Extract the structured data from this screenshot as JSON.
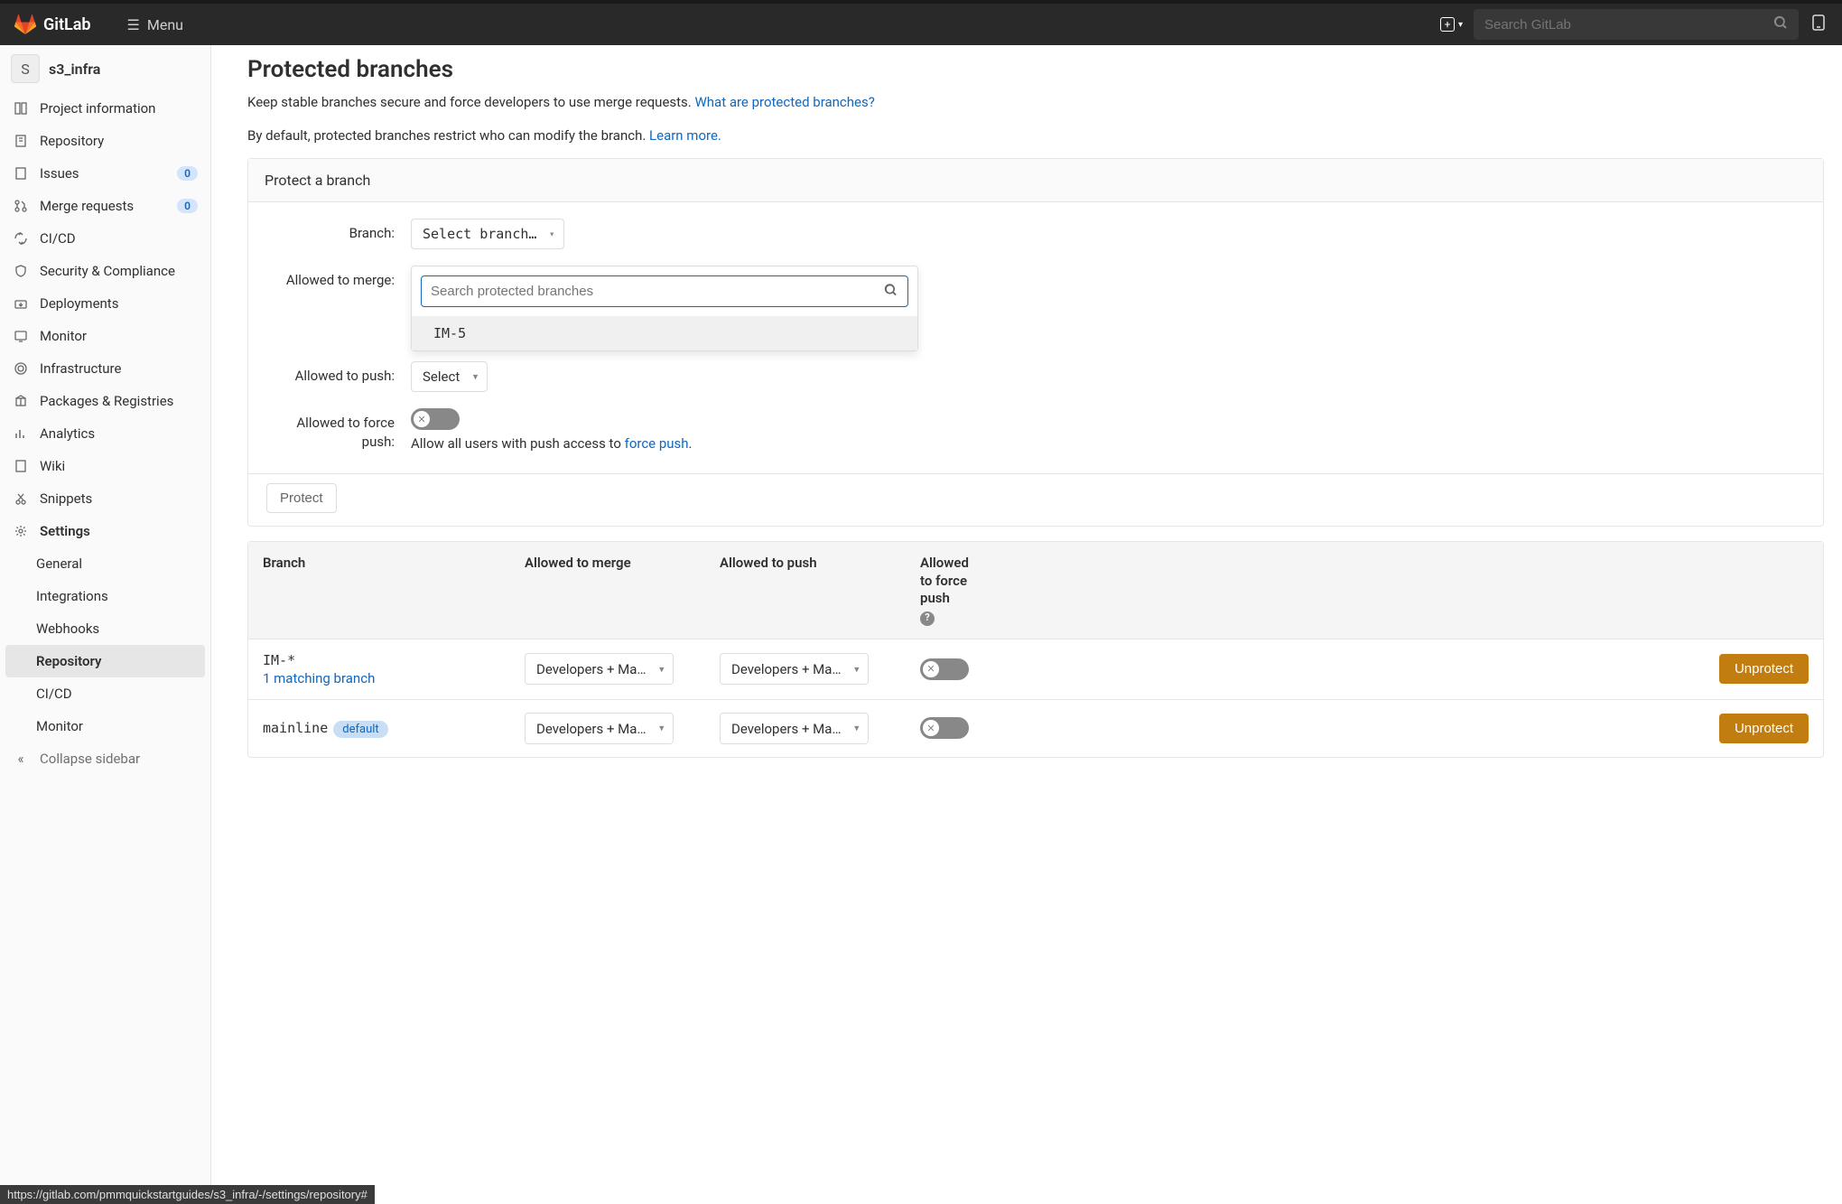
{
  "header": {
    "brand": "GitLab",
    "menu_label": "Menu",
    "search_placeholder": "Search GitLab"
  },
  "sidebar": {
    "project_initial": "S",
    "project_name": "s3_infra",
    "items": [
      {
        "label": "Project information",
        "icon": "info"
      },
      {
        "label": "Repository",
        "icon": "repo"
      },
      {
        "label": "Issues",
        "icon": "issues",
        "badge": "0"
      },
      {
        "label": "Merge requests",
        "icon": "mr",
        "badge": "0"
      },
      {
        "label": "CI/CD",
        "icon": "cicd"
      },
      {
        "label": "Security & Compliance",
        "icon": "shield"
      },
      {
        "label": "Deployments",
        "icon": "deploy"
      },
      {
        "label": "Monitor",
        "icon": "monitor"
      },
      {
        "label": "Infrastructure",
        "icon": "infra"
      },
      {
        "label": "Packages & Registries",
        "icon": "package"
      },
      {
        "label": "Analytics",
        "icon": "analytics"
      },
      {
        "label": "Wiki",
        "icon": "wiki"
      },
      {
        "label": "Snippets",
        "icon": "snippets"
      },
      {
        "label": "Settings",
        "icon": "settings"
      }
    ],
    "settings_sub": [
      "General",
      "Integrations",
      "Webhooks",
      "Repository",
      "CI/CD",
      "Monitor"
    ],
    "collapse_label": "Collapse sidebar"
  },
  "main": {
    "title": "Protected branches",
    "desc1_a": "Keep stable branches secure and force developers to use merge requests. ",
    "desc1_link": "What are protected branches?",
    "desc2_a": "By default, protected branches restrict who can modify the branch. ",
    "desc2_link": "Learn more.",
    "panel_header": "Protect a branch",
    "form": {
      "branch_label": "Branch:",
      "branch_select": "Select branch…",
      "search_placeholder": "Search protected branches",
      "search_option": "IM-5",
      "merge_label": "Allowed to merge:",
      "push_label": "Allowed to push:",
      "push_select": "Select",
      "force_label": "Allowed to force push:",
      "force_desc_a": "Allow all users with push access to ",
      "force_desc_link": "force push",
      "force_desc_b": "."
    },
    "protect_btn": "Protect",
    "table": {
      "headers": {
        "branch": "Branch",
        "merge": "Allowed to merge",
        "push": "Allowed to push",
        "force": "Allowed to force push"
      },
      "rows": [
        {
          "branch": "IM-*",
          "matching": "1 matching branch",
          "merge": "Developers + Ma…",
          "push": "Developers + Ma…",
          "unprotect": "Unprotect"
        },
        {
          "branch": "mainline",
          "default": "default",
          "merge": "Developers + Ma…",
          "push": "Developers + Ma…",
          "unprotect": "Unprotect"
        }
      ]
    }
  },
  "status_url": "https://gitlab.com/pmmquickstartguides/s3_infra/-/settings/repository#"
}
